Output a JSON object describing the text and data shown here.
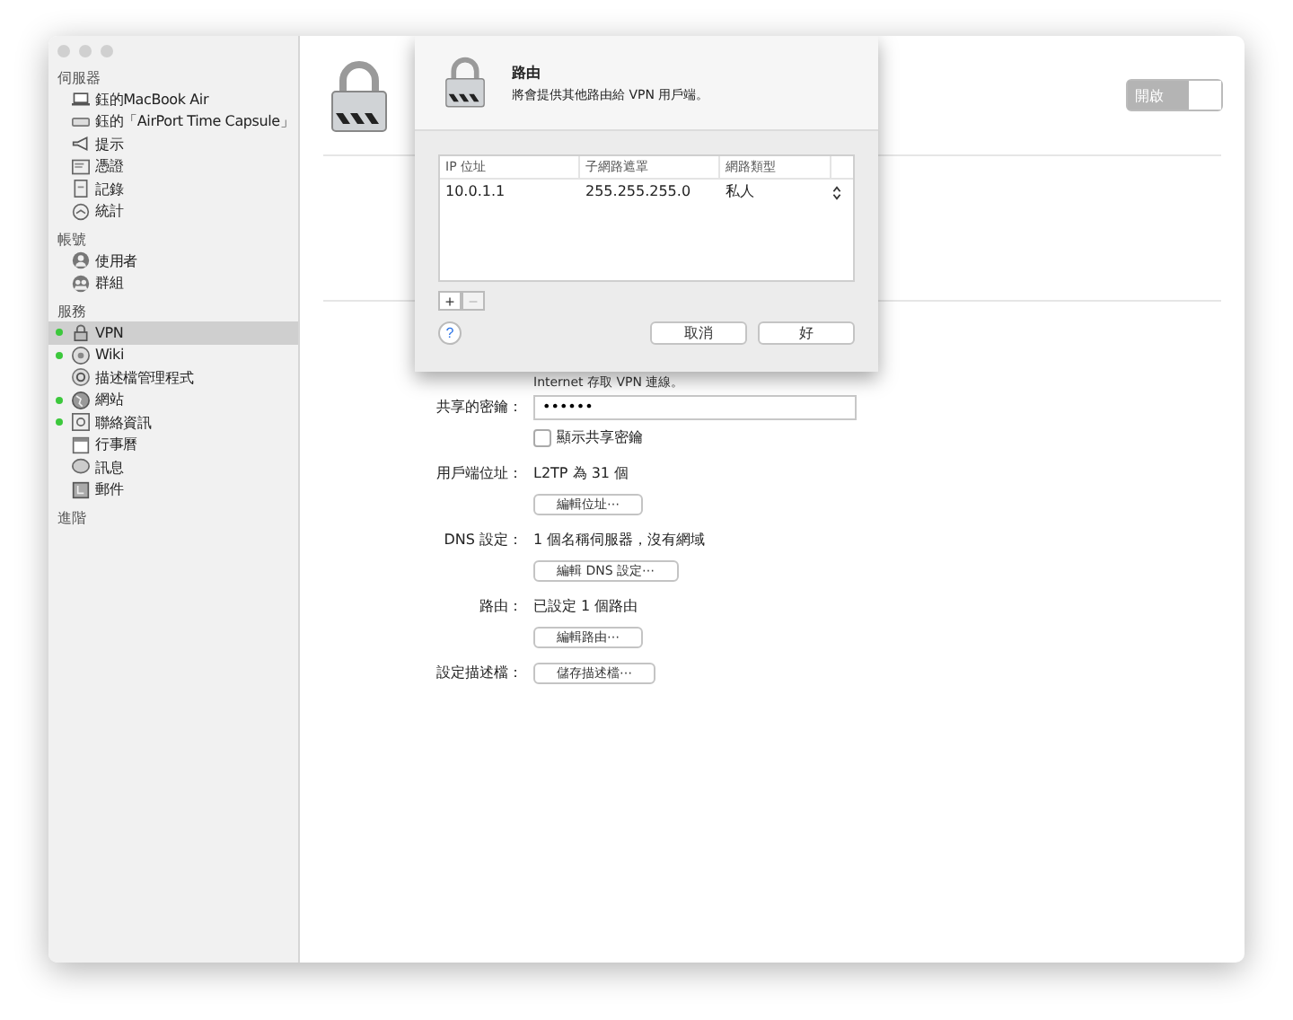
{
  "sidebar": {
    "sections": [
      {
        "title": "伺服器",
        "items": [
          {
            "label": "鈺的MacBook Air",
            "selected": false,
            "running": false
          },
          {
            "label": "鈺的「AirPort Time Capsule」",
            "selected": false,
            "running": false
          },
          {
            "label": "提示",
            "selected": false,
            "running": false
          },
          {
            "label": "憑證",
            "selected": false,
            "running": false
          },
          {
            "label": "記錄",
            "selected": false,
            "running": false
          },
          {
            "label": "統計",
            "selected": false,
            "running": false
          }
        ]
      },
      {
        "title": "帳號",
        "items": [
          {
            "label": "使用者",
            "selected": false,
            "running": false
          },
          {
            "label": "群組",
            "selected": false,
            "running": false
          }
        ]
      },
      {
        "title": "服務",
        "items": [
          {
            "label": "VPN",
            "selected": true,
            "running": true
          },
          {
            "label": "Wiki",
            "selected": false,
            "running": true
          },
          {
            "label": "描述檔管理程式",
            "selected": false,
            "running": false
          },
          {
            "label": "網站",
            "selected": false,
            "running": true
          },
          {
            "label": "聯絡資訊",
            "selected": false,
            "running": true
          },
          {
            "label": "行事曆",
            "selected": false,
            "running": false
          },
          {
            "label": "訊息",
            "selected": false,
            "running": false
          },
          {
            "label": "郵件",
            "selected": false,
            "running": false
          }
        ]
      },
      {
        "title": "進階"
      }
    ]
  },
  "service": {
    "toggle": {
      "label": "開啟",
      "on": true
    },
    "note": "Internet 存取 VPN 連線。",
    "settings": [
      {
        "kind": "password",
        "label": "共享的密鑰：",
        "value": "••••••",
        "checkbox": {
          "label": "顯示共享密鑰",
          "checked": false
        }
      },
      {
        "kind": "info",
        "label": "用戶端位址：",
        "value": "L2TP 為 31 個",
        "button": "編輯位址⋯"
      },
      {
        "kind": "info",
        "label": "DNS 設定：",
        "value": "1 個名稱伺服器，沒有網域",
        "button": "編輯 DNS 設定⋯"
      },
      {
        "kind": "info",
        "label": "路由：",
        "value": "已設定 1 個路由",
        "button": "編輯路由⋯"
      },
      {
        "kind": "button",
        "label": "設定描述檔：",
        "button": "儲存描述檔⋯"
      }
    ]
  },
  "sheet": {
    "title": "路由",
    "subtitle": "將會提供其他路由給 VPN 用戶端。",
    "columns": [
      "IP 位址",
      "子網路遮罩",
      "網路類型"
    ],
    "rows": [
      {
        "cells": [
          "10.0.1.1",
          "255.255.255.0",
          "私人"
        ]
      }
    ],
    "add_button": {
      "label": "+",
      "disabled": false
    },
    "remove_button": {
      "label": "−",
      "disabled": true
    },
    "help": "?",
    "buttons": [
      "取消",
      "好"
    ]
  }
}
